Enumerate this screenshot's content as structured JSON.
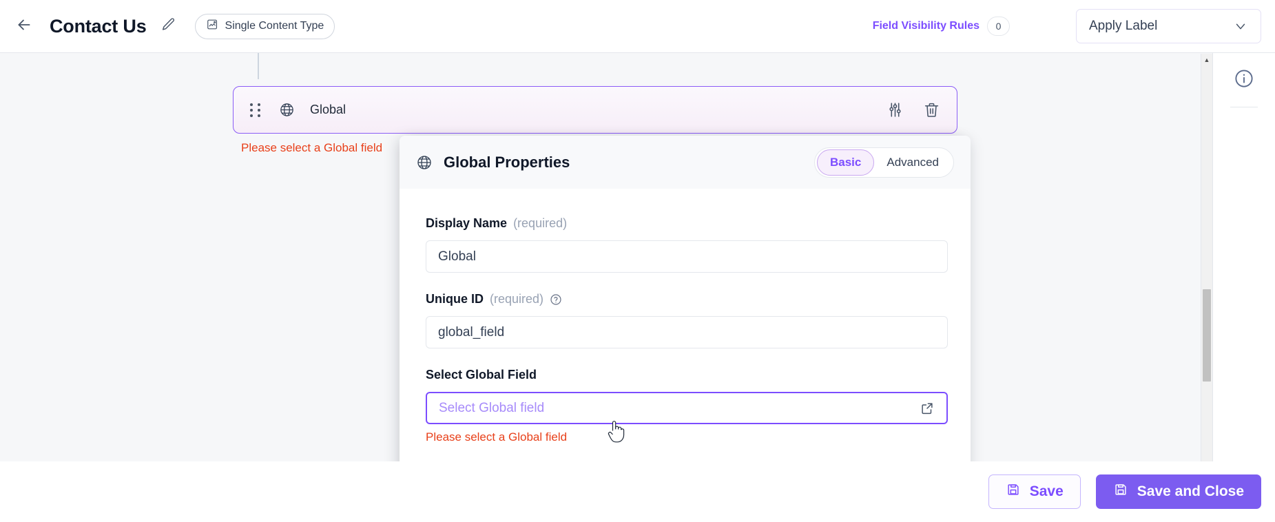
{
  "header": {
    "back_icon": "arrow-left-icon",
    "title": "Contact Us",
    "edit_icon": "pencil-icon",
    "content_type_chip": {
      "icon": "content-type-icon",
      "label": "Single Content Type"
    },
    "field_visibility_rules": {
      "label": "Field Visibility Rules",
      "count": "0"
    },
    "apply_label": {
      "value": "Apply Label",
      "chevron_icon": "chevron-down-icon"
    }
  },
  "canvas": {
    "field_row": {
      "drag_icon": "drag-handle-icon",
      "type_icon": "globe-icon",
      "name": "Global",
      "settings_icon": "sliders-icon",
      "delete_icon": "trash-icon"
    },
    "row_error": "Please select a Global field"
  },
  "properties_panel": {
    "icon": "globe-icon",
    "title": "Global Properties",
    "tabs": [
      {
        "label": "Basic",
        "active": true
      },
      {
        "label": "Advanced",
        "active": false
      }
    ],
    "fields": {
      "display_name": {
        "label": "Display Name",
        "required_text": "(required)",
        "value": "Global",
        "placeholder": "Display Name"
      },
      "unique_id": {
        "label": "Unique ID",
        "required_text": "(required)",
        "help_icon": "question-circle-icon",
        "value": "global_field",
        "placeholder": "Unique ID"
      },
      "select_global_field": {
        "label": "Select Global Field",
        "placeholder": "Select Global field",
        "value": "",
        "external_icon": "external-link-icon",
        "error": "Please select a Global field"
      }
    }
  },
  "right_rail": {
    "info_icon": "info-circle-icon"
  },
  "scrollbar": {
    "up_arrow_icon": "caret-up-icon",
    "down_arrow_icon": "caret-down-icon"
  },
  "footer": {
    "save": {
      "icon": "save-icon",
      "label": "Save"
    },
    "save_and_close": {
      "icon": "save-icon",
      "label": "Save and Close"
    }
  },
  "cursor": {
    "icon": "pointer-hand-cursor"
  },
  "colors": {
    "accent": "#7c4dff",
    "primary_button": "#7c5cf0",
    "error": "#e8401a",
    "field_border_active": "#8b5cf6",
    "rail_icon": "#5b6b8c"
  }
}
